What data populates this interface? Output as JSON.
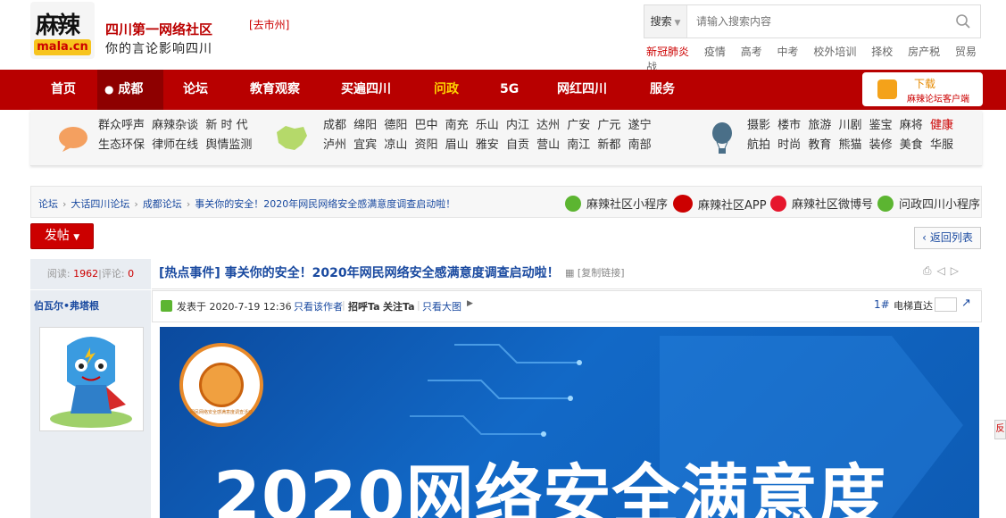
{
  "header": {
    "logo_main": "麻辣",
    "logo_domain": "mala.cn",
    "site_name": "四川第一网络社区",
    "slogan": "你的言论影响四川",
    "city_link": "[去市州]"
  },
  "search": {
    "type_label": "搜索",
    "placeholder": "请输入搜索内容",
    "hot_words": [
      "新冠肺炎",
      "疫情",
      "高考",
      "中考",
      "校外培训",
      "择校",
      "房产税",
      "贸易战"
    ]
  },
  "nav": {
    "items": [
      "首页",
      "成都",
      "论坛",
      "教育观察",
      "买遍四川",
      "问政",
      "5G",
      "网红四川",
      "服务"
    ],
    "download_title": "下载",
    "download_sub": "麻辣论坛客户端"
  },
  "subpanel": {
    "group1_row1": [
      "群众呼声",
      "麻辣杂谈",
      "新 时 代"
    ],
    "group1_row2": [
      "生态环保",
      "律师在线",
      "舆情监测"
    ],
    "cities_row1": [
      "成都",
      "绵阳",
      "德阳",
      "巴中",
      "南充",
      "乐山",
      "内江",
      "达州",
      "广安",
      "广元",
      "遂宁"
    ],
    "cities_row2": [
      "泸州",
      "宜宾",
      "凉山",
      "资阳",
      "眉山",
      "雅安",
      "自贡",
      "营山",
      "南江",
      "新都",
      "南部"
    ],
    "topics_row1": [
      "摄影",
      "楼市",
      "旅游",
      "川剧",
      "鉴宝",
      "麻将",
      "健康"
    ],
    "topics_row2": [
      "航拍",
      "时尚",
      "教育",
      "熊猫",
      "装修",
      "美食",
      "华服"
    ]
  },
  "breadcrumb": {
    "items": [
      "论坛",
      "大话四川论坛",
      "成都论坛",
      "事关你的安全！2020年网民网络安全感满意度调查启动啦！"
    ],
    "tools": [
      "麻辣社区小程序",
      "麻辣社区APP",
      "麻辣社区微博号",
      "问政四川小程序"
    ]
  },
  "actions": {
    "post_label": "发帖",
    "back_label": "返回列表"
  },
  "thread": {
    "views_label": "阅读:",
    "views": "1962",
    "replies_label": "评论:",
    "replies": "0",
    "title": "[热点事件] 事关你的安全！2020年网民网络安全感满意度调查启动啦！",
    "copy_link": "[复制链接]"
  },
  "post": {
    "author": "伯瓦尔•弗塔根",
    "posted_at": "发表于 2020-7-19 12:36",
    "only_author": "只看该作者",
    "greet": "招呼Ta",
    "follow": "关注Ta",
    "big_image": "只看大图",
    "floor": "1#",
    "elevator": "电梯直达"
  },
  "banner": {
    "headline": "2020网络安全满意度",
    "seal_text": "网民网络安全感满意度调查活动"
  },
  "colors": {
    "nav_bg": "#b80000",
    "accent_red": "#cc0000",
    "link_blue": "#1a4aa0"
  }
}
